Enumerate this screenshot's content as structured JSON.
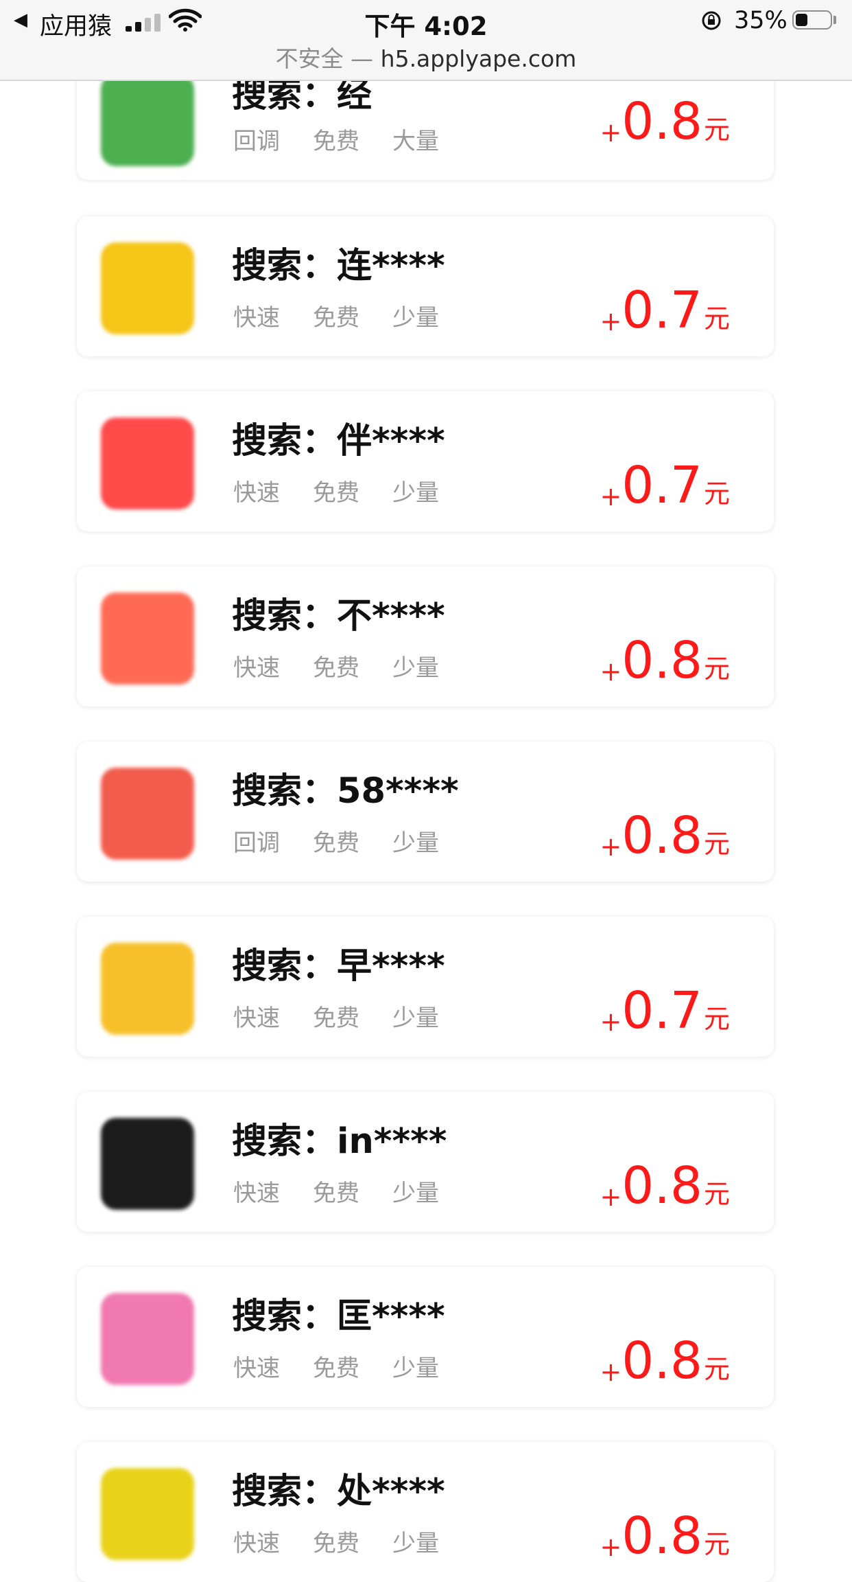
{
  "status_bar": {
    "back_label": "◀",
    "app": "应用猿",
    "time": "下午 4:02",
    "battery": "35%",
    "battery_level": 0.35
  },
  "url_bar": {
    "insecure": "不安全",
    "separator": " — ",
    "host": "h5.applyape.com"
  },
  "tasks": [
    {
      "title": "搜索：经",
      "tags": [
        "回调",
        "免费",
        "大量"
      ],
      "plus": "+",
      "amount": "0.8",
      "unit": "元",
      "icon_color": "#4caf50"
    },
    {
      "title": "搜索：连****",
      "tags": [
        "快速",
        "免费",
        "少量"
      ],
      "plus": "+",
      "amount": "0.7",
      "unit": "元",
      "icon_color": "#f5c518"
    },
    {
      "title": "搜索：伴****",
      "tags": [
        "快速",
        "免费",
        "少量"
      ],
      "plus": "+",
      "amount": "0.7",
      "unit": "元",
      "icon_color": "#ff4a4a"
    },
    {
      "title": "搜索：不****",
      "tags": [
        "快速",
        "免费",
        "少量"
      ],
      "plus": "+",
      "amount": "0.8",
      "unit": "元",
      "icon_color": "#ff6a55"
    },
    {
      "title": "搜索：58****",
      "tags": [
        "回调",
        "免费",
        "少量"
      ],
      "plus": "+",
      "amount": "0.8",
      "unit": "元",
      "icon_color": "#f25c4c"
    },
    {
      "title": "搜索：早****",
      "tags": [
        "快速",
        "免费",
        "少量"
      ],
      "plus": "+",
      "amount": "0.7",
      "unit": "元",
      "icon_color": "#f7c02a"
    },
    {
      "title": "搜索：in****",
      "tags": [
        "快速",
        "免费",
        "少量"
      ],
      "plus": "+",
      "amount": "0.8",
      "unit": "元",
      "icon_color": "#1c1c1c"
    },
    {
      "title": "搜索：匡****",
      "tags": [
        "快速",
        "免费",
        "少量"
      ],
      "plus": "+",
      "amount": "0.8",
      "unit": "元",
      "icon_color": "#f07ab0"
    },
    {
      "title": "搜索：处****",
      "tags": [
        "快速",
        "免费",
        "少量"
      ],
      "plus": "+",
      "amount": "0.8",
      "unit": "元",
      "icon_color": "#e9d21a"
    }
  ]
}
